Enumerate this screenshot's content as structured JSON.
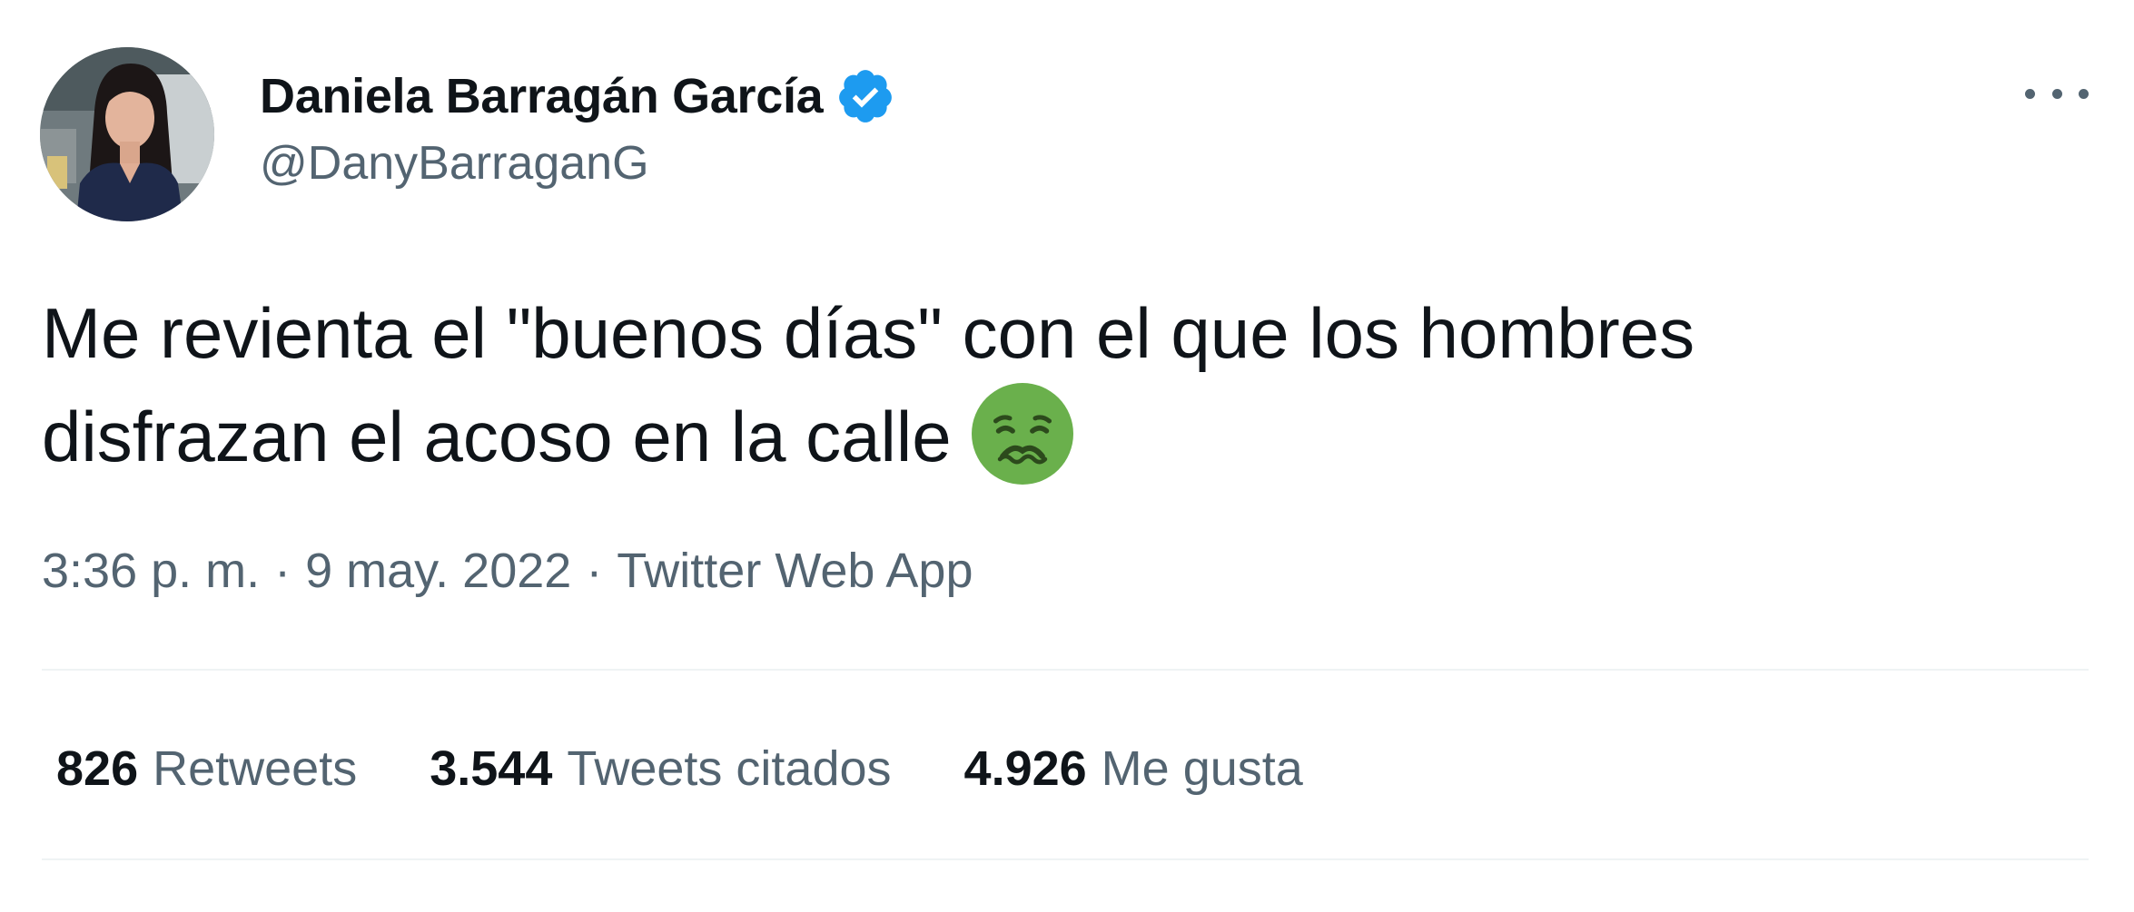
{
  "tweet": {
    "author": {
      "display_name": "Daniela Barragán García",
      "handle": "@DanyBarraganG",
      "verified_icon": "verified-badge-icon",
      "verified_color": "#1d9bf0"
    },
    "text_lines": [
      "Me revienta el \"buenos días\" con el que los hombres",
      "disfrazan el acoso en la calle"
    ],
    "emoji": "nauseated-face-emoji",
    "meta": {
      "time": "3:36 p. m.",
      "separator": "·",
      "date": "9 may. 2022",
      "source": "Twitter Web App"
    },
    "stats": [
      {
        "count": "826",
        "label": "Retweets"
      },
      {
        "count": "3.544",
        "label": "Tweets citados"
      },
      {
        "count": "4.926",
        "label": "Me gusta"
      }
    ],
    "more_icon": "more-options-icon"
  },
  "colors": {
    "text_primary": "#0f1419",
    "text_secondary": "#536471",
    "divider": "#eff3f4",
    "emoji_green": "#6ab04c"
  }
}
